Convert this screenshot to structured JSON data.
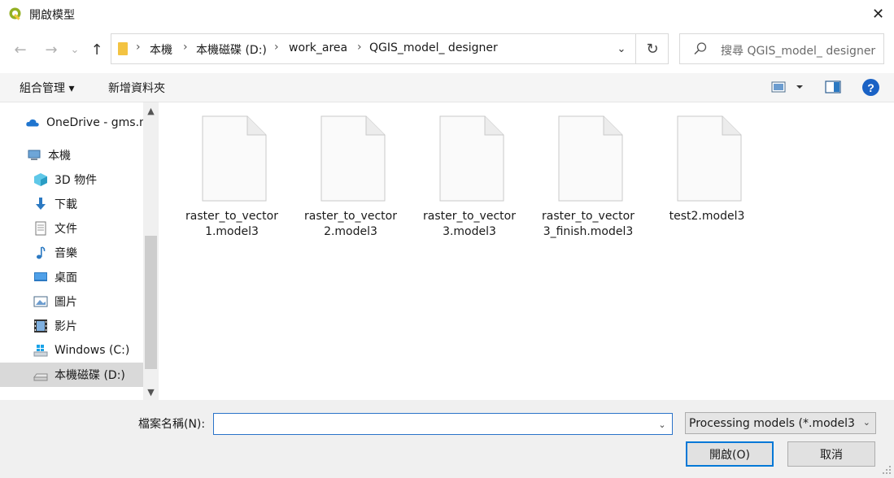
{
  "window": {
    "title": "開啟模型",
    "close_glyph": "✕"
  },
  "nav": {
    "back_glyph": "←",
    "forward_glyph": "→",
    "recent_glyph": "⌄",
    "up_glyph": "↑"
  },
  "address": {
    "sep": "›",
    "crumbs": [
      "本機",
      "本機磁碟 (D:)",
      "work_area",
      "QGIS_model_ designer"
    ],
    "dropdown_glyph": "⌄",
    "refresh_glyph": "↻"
  },
  "search": {
    "placeholder": "搜尋 QGIS_model_ designer",
    "icon": "search-icon"
  },
  "toolbar": {
    "organize_label": "組合管理 ▾",
    "new_folder_label": "新增資料夾",
    "help_label": "?"
  },
  "sidebar": {
    "items": [
      {
        "label": "OneDrive - gms.n",
        "icon": "cloud-icon"
      },
      {
        "label": "本機",
        "icon": "computer-icon"
      },
      {
        "label": "3D 物件",
        "icon": "cube-icon"
      },
      {
        "label": "下載",
        "icon": "download-icon"
      },
      {
        "label": "文件",
        "icon": "document-icon"
      },
      {
        "label": "音樂",
        "icon": "music-icon"
      },
      {
        "label": "桌面",
        "icon": "desktop-icon"
      },
      {
        "label": "圖片",
        "icon": "picture-icon"
      },
      {
        "label": "影片",
        "icon": "film-icon"
      },
      {
        "label": "Windows (C:)",
        "icon": "windows-drive-icon"
      },
      {
        "label": "本機磁碟 (D:)",
        "icon": "drive-icon"
      }
    ],
    "selected_index": 10,
    "scroll_up_glyph": "▲",
    "scroll_down_glyph": "▼"
  },
  "files": [
    {
      "name_line1": "raster_to_vector",
      "name_line2": "1.model3"
    },
    {
      "name_line1": "raster_to_vector",
      "name_line2": "2.model3"
    },
    {
      "name_line1": "raster_to_vector",
      "name_line2": "3.model3"
    },
    {
      "name_line1": "raster_to_vector",
      "name_line2": "3_finish.model3"
    },
    {
      "name_line1": "test2.model3",
      "name_line2": ""
    }
  ],
  "bottom": {
    "filename_label": "檔案名稱(N):",
    "filename_value": "",
    "filename_dropdown_glyph": "⌄",
    "filetype_value": "Processing models (*.model3",
    "filetype_arrow": "⌄",
    "open_label": "開啟(O)",
    "cancel_label": "取消"
  }
}
